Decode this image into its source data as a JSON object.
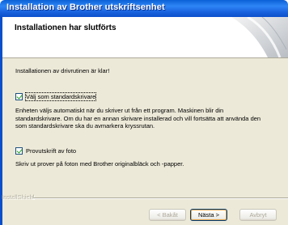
{
  "window": {
    "title": "Installation av Brother utskriftsenhet"
  },
  "header": {
    "title": "Installationen har slutförts"
  },
  "content": {
    "intro": "Installationen av drivrutinen är klar!",
    "option1": {
      "label": "Välj som standardskrivare",
      "checked": true,
      "description": "Enheten väljs automatiskt när du skriver ut från ett program. Maskinen blir din standardskrivare. Om du har en annan skrivare installerad och vill fortsätta att använda den som standardskrivare ska du avmarkera kryssrutan."
    },
    "option2": {
      "label": "Provutskrift av foto",
      "checked": true,
      "description": "Skriv ut prover på foton med Brother originalbläck och -papper."
    }
  },
  "footer": {
    "brand": "InstallShield",
    "back_label": "< Bakåt",
    "next_label": "Nästa >",
    "cancel_label": "Avbryt"
  },
  "colors": {
    "titlebar": "#0b4fca",
    "dialog_bg": "#ece9d8",
    "check": "#21a121"
  }
}
